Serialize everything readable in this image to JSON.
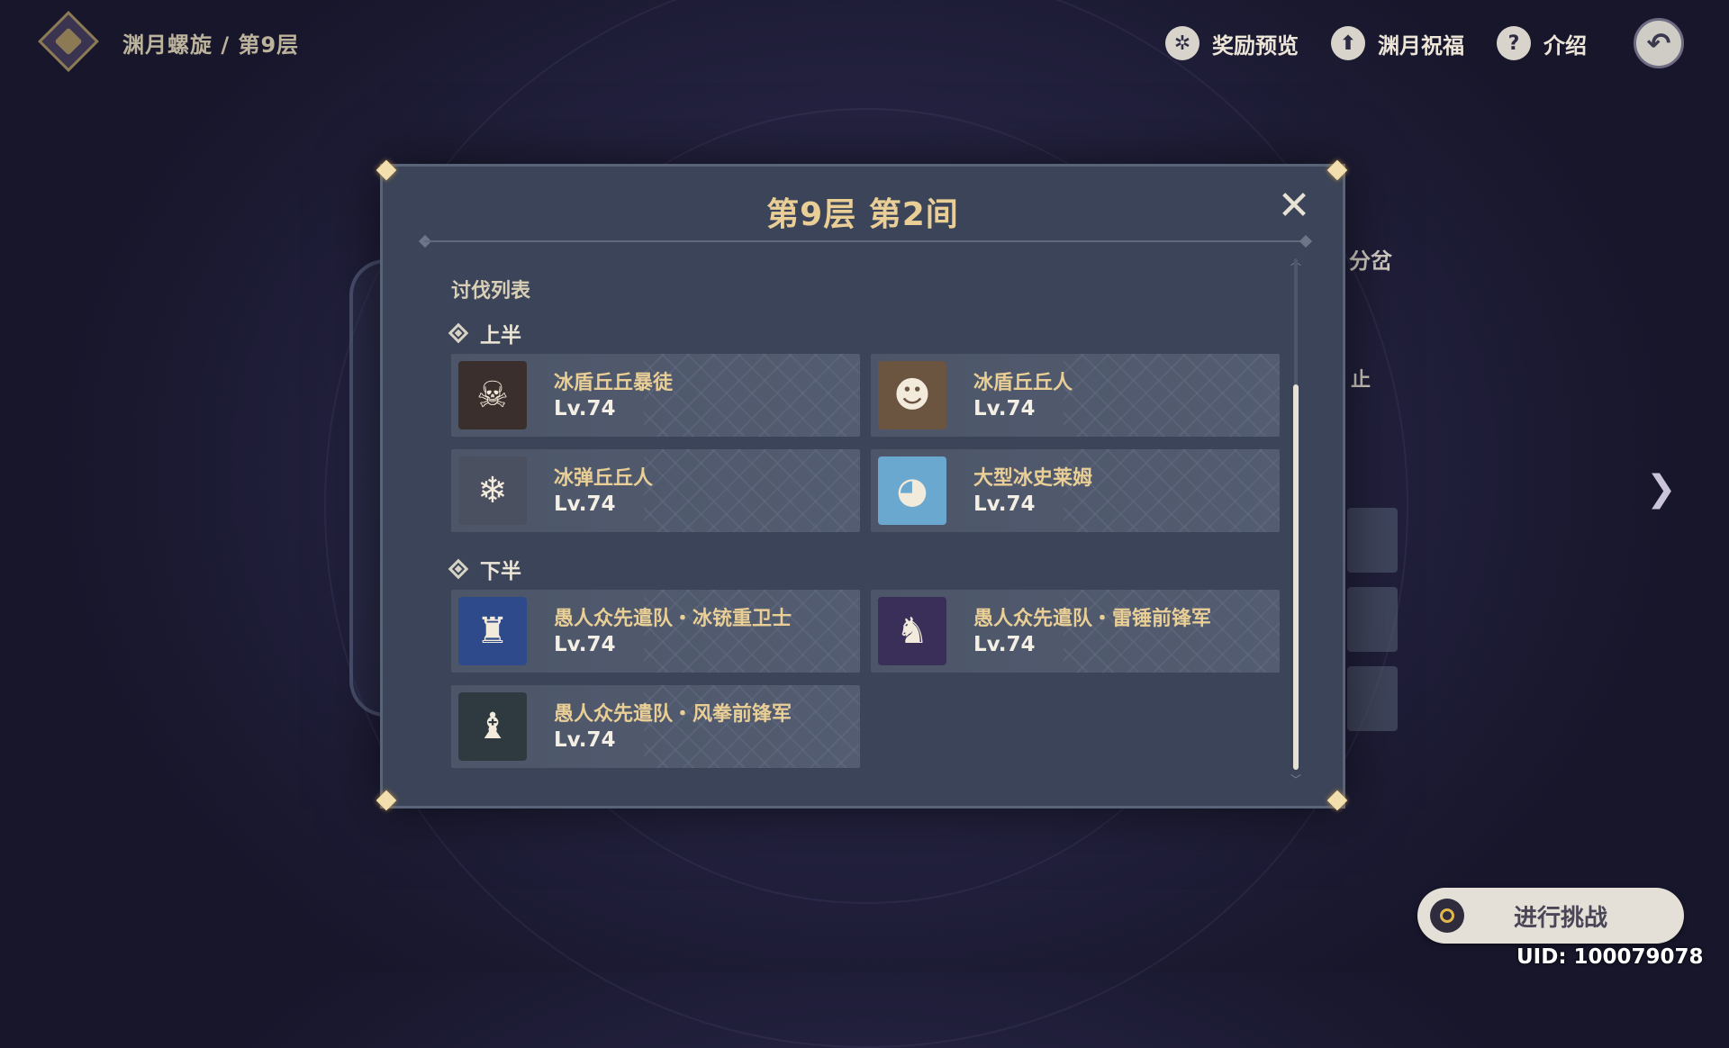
{
  "header": {
    "breadcrumb": "渊月螺旋 / 第9层",
    "buttons": [
      {
        "label": "奖励预览",
        "icon": "gear-badge-icon"
      },
      {
        "label": "渊月祝福",
        "icon": "upgrade-arrow-icon"
      },
      {
        "label": "介绍",
        "icon": "question-icon"
      }
    ],
    "back_icon": "back-arrow-icon"
  },
  "background_panel": {
    "partial_label_1": "分岔",
    "partial_label_2": "止"
  },
  "modal": {
    "title": "第9层 第2间",
    "close_icon": "close-icon",
    "section_title": "讨伐列表",
    "groups": [
      {
        "label": "上半",
        "enemies": [
          {
            "name": "冰盾丘丘暴徒",
            "level": "Lv.74",
            "icon": "masked-hilichurl-icon",
            "color": "#3a2f2c"
          },
          {
            "name": "冰盾丘丘人",
            "level": "Lv.74",
            "icon": "hilichurl-icon",
            "color": "#6b5440"
          },
          {
            "name": "冰弹丘丘人",
            "level": "Lv.74",
            "icon": "cryo-hilichurl-icon",
            "color": "#4a5060"
          },
          {
            "name": "大型冰史莱姆",
            "level": "Lv.74",
            "icon": "cryo-slime-icon",
            "color": "#6aa8d0"
          }
        ]
      },
      {
        "label": "下半",
        "enemies": [
          {
            "name": "愚人众先遣队・冰铳重卫士",
            "level": "Lv.74",
            "icon": "fatui-cryogunner-icon",
            "color": "#2e4a8a"
          },
          {
            "name": "愚人众先遣队・雷锤前锋军",
            "level": "Lv.74",
            "icon": "fatui-electro-icon",
            "color": "#3a2f58"
          },
          {
            "name": "愚人众先遣队・风拳前锋军",
            "level": "Lv.74",
            "icon": "fatui-anemo-icon",
            "color": "#2f3a40"
          }
        ]
      }
    ]
  },
  "footer": {
    "challenge_label": "进行挑战",
    "uid": "UID: 100079078"
  }
}
